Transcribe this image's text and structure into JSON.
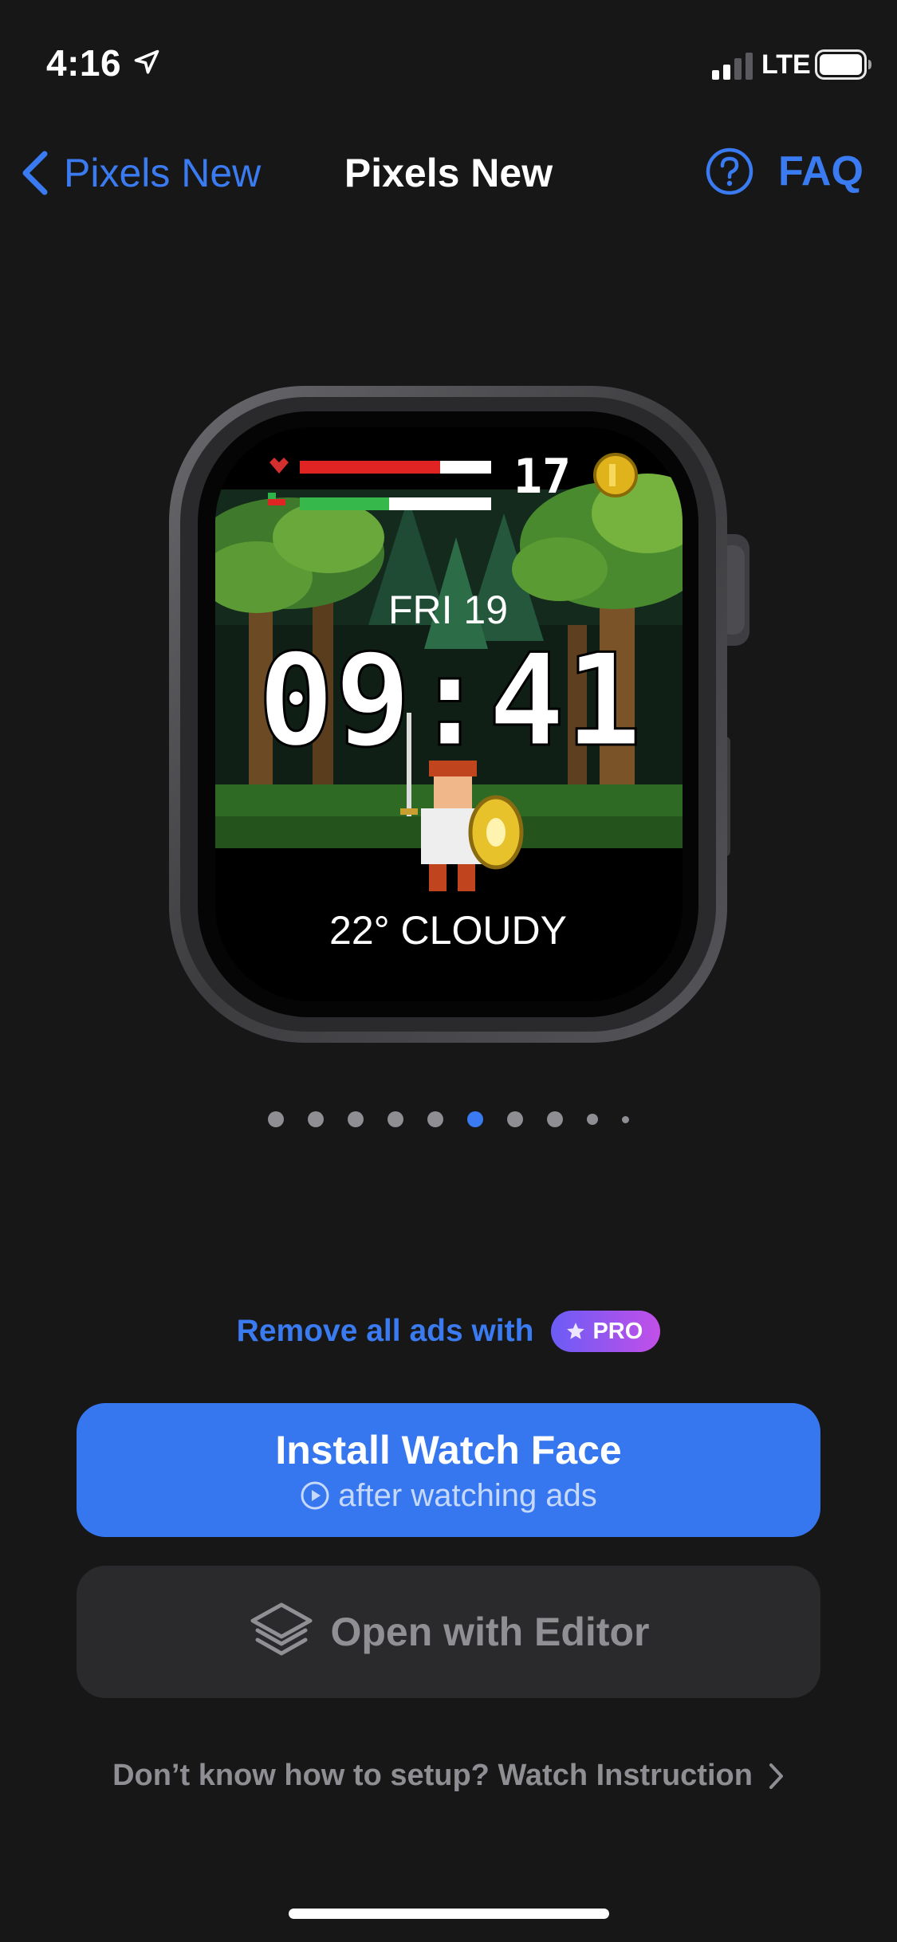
{
  "status_bar": {
    "time": "4:16",
    "network": "LTE"
  },
  "nav": {
    "back_label": "Pixels New",
    "title": "Pixels New",
    "faq_label": "FAQ"
  },
  "watch_face": {
    "coin_count": "17",
    "date": "FRI 19",
    "time": "09:41",
    "weather": "22° CLOUDY"
  },
  "pagination": {
    "count": 10,
    "active_index": 5
  },
  "promo": {
    "text": "Remove all ads with",
    "badge": "PRO"
  },
  "install_button": {
    "title": "Install Watch Face",
    "subtitle": "after watching ads"
  },
  "editor_button": {
    "label": "Open with Editor"
  },
  "instruction_link": {
    "label": "Don’t know how to setup? Watch Instruction"
  },
  "colors": {
    "accent": "#3a7bf2",
    "background": "#171718",
    "pro_gradient_start": "#6b5cf6",
    "pro_gradient_end": "#c24fe8"
  }
}
